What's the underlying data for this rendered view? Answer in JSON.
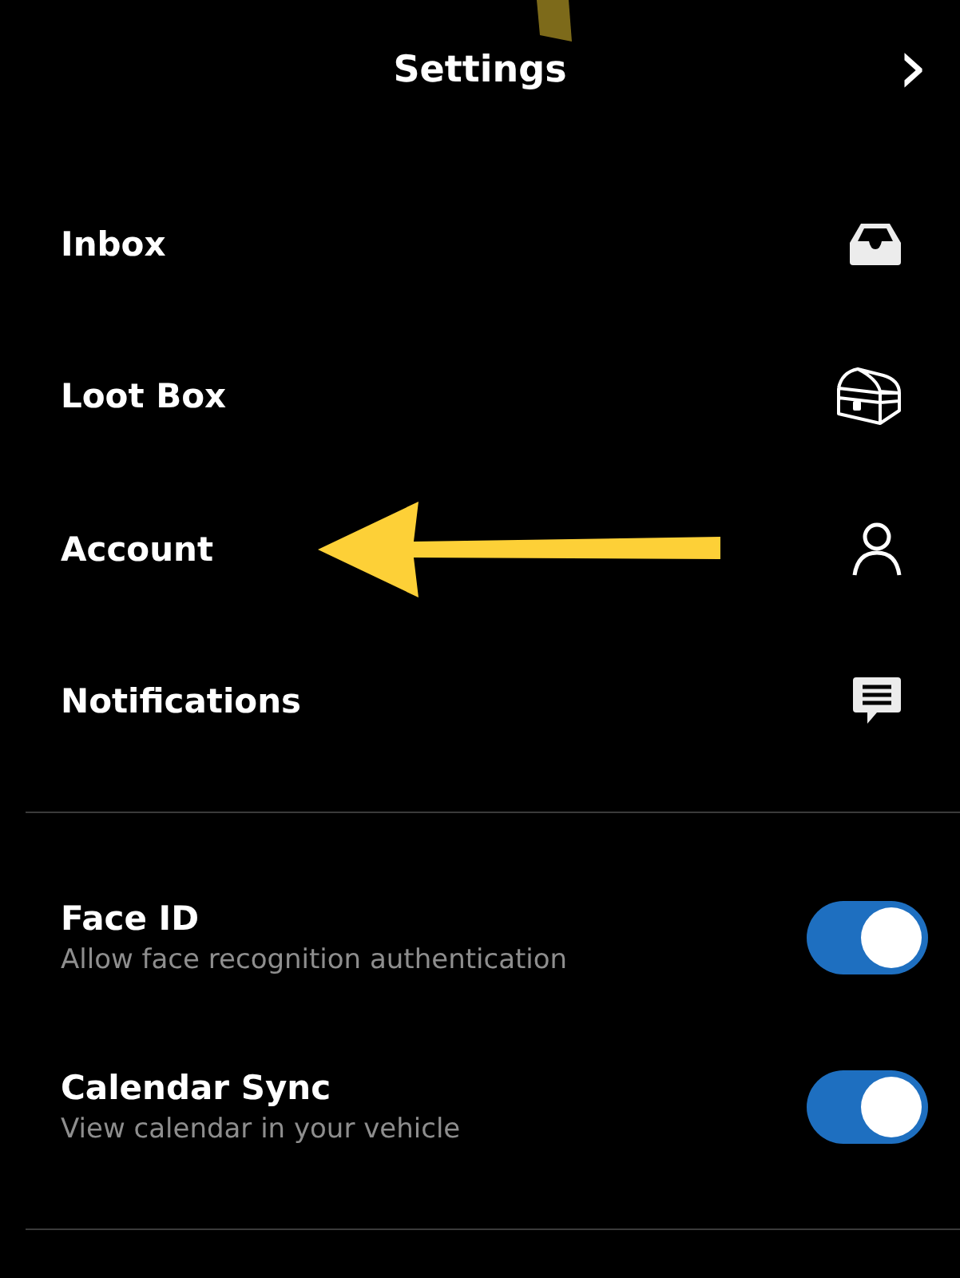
{
  "header": {
    "title": "Settings",
    "forward_glyph": "›"
  },
  "menu": [
    {
      "label": "Inbox",
      "kind": "inbox",
      "arrow_annotation": false
    },
    {
      "label": "Loot Box",
      "kind": "chest",
      "arrow_annotation": false
    },
    {
      "label": "Account",
      "kind": "person",
      "arrow_annotation": true
    },
    {
      "label": "Notifications",
      "kind": "message",
      "arrow_annotation": false
    }
  ],
  "toggles": [
    {
      "label": "Face ID",
      "description": "Allow face recognition authentication",
      "on": true
    },
    {
      "label": "Calendar Sync",
      "description": "View calendar in your vehicle",
      "on": true
    }
  ]
}
